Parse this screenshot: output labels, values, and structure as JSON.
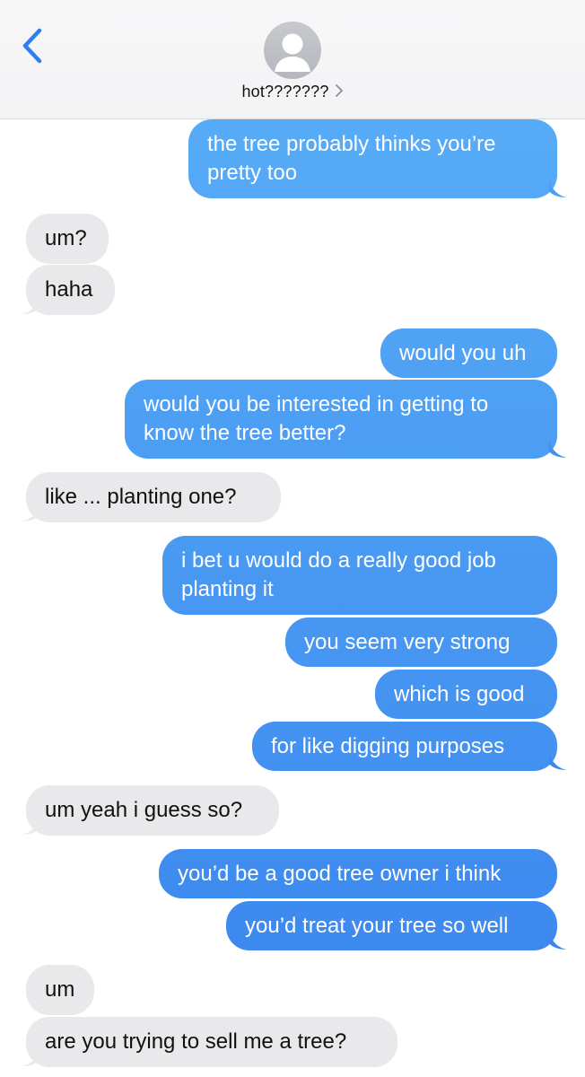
{
  "header": {
    "contact_name": "hot???????",
    "back_icon": "chevron-left-icon",
    "avatar_icon": "person-silhouette-icon",
    "accent": "#2f7ef1"
  },
  "messages": [
    {
      "from": "me",
      "lines": [
        "the tree probably thinks you’re",
        "pretty too"
      ]
    },
    {
      "from": "them",
      "lines": [
        "um?"
      ]
    },
    {
      "from": "them",
      "lines": [
        "haha"
      ]
    },
    {
      "from": "me",
      "lines": [
        "would you uh"
      ]
    },
    {
      "from": "me",
      "lines": [
        "would you be interested in getting to",
        "know the tree better?"
      ]
    },
    {
      "from": "them",
      "lines": [
        "like ... planting one?"
      ]
    },
    {
      "from": "me",
      "lines": [
        "i bet u would do a really good job",
        "planting it"
      ]
    },
    {
      "from": "me",
      "lines": [
        "you seem very strong"
      ]
    },
    {
      "from": "me",
      "lines": [
        "which is good"
      ]
    },
    {
      "from": "me",
      "lines": [
        "for like digging purposes"
      ]
    },
    {
      "from": "them",
      "lines": [
        "um yeah i guess so?"
      ]
    },
    {
      "from": "me",
      "lines": [
        "you’d be a good tree owner i think"
      ]
    },
    {
      "from": "me",
      "lines": [
        "you’d treat your tree so well"
      ]
    },
    {
      "from": "them",
      "lines": [
        "um"
      ]
    },
    {
      "from": "them",
      "lines": [
        "are you trying to sell me a tree?"
      ]
    }
  ],
  "colors": {
    "outgoing_top": "#5ab0f7",
    "outgoing_bottom": "#3984ee",
    "incoming": "#e9e9eb"
  }
}
